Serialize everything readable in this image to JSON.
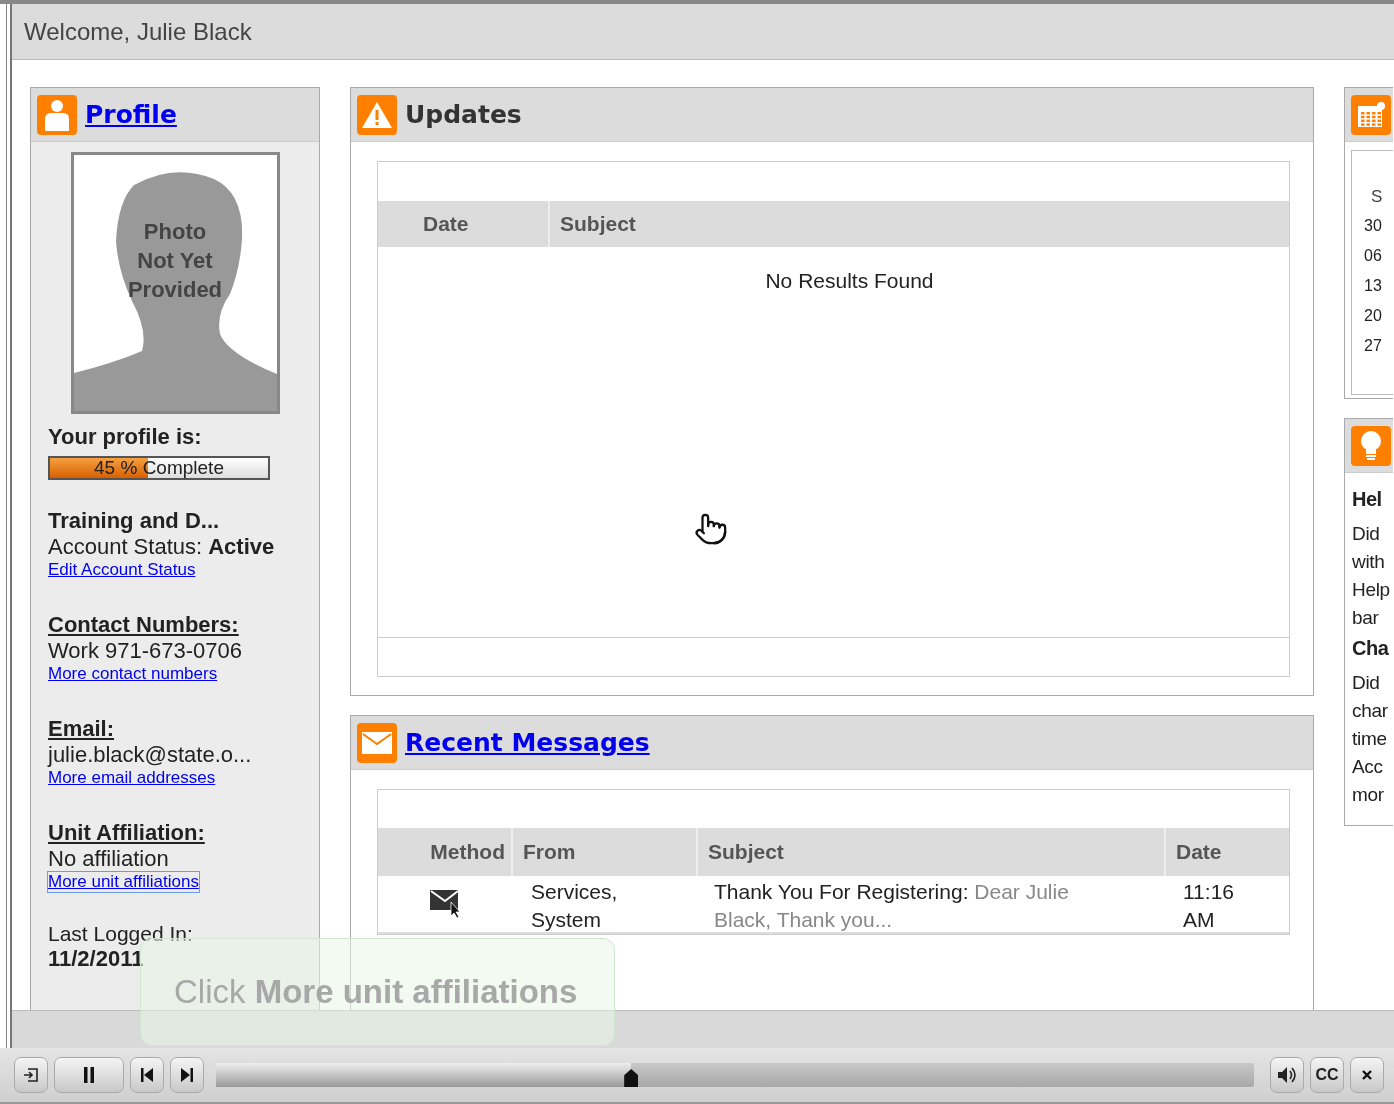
{
  "welcome": "Welcome, Julie Black",
  "profile": {
    "title": "Profile",
    "photo_text": [
      "Photo",
      "Not Yet",
      "Provided"
    ],
    "status_label": "Your profile is:",
    "progress": {
      "level": 0.45,
      "text": "45 % Complete"
    },
    "training": "Training and D...",
    "account_status": {
      "label": "Account Status:",
      "value": "Active"
    },
    "edit_link": "Edit Account Status",
    "sections": [
      {
        "heading": "Contact Numbers:",
        "value": "Work 971-673-0706",
        "link": "More contact numbers",
        "focused": false
      },
      {
        "heading": "Email:",
        "value": "julie.black@state.o...",
        "link": "More email addresses",
        "focused": false
      },
      {
        "heading": "Unit Affiliation:",
        "value": "No affiliation",
        "link": "More unit affiliations",
        "focused": true
      }
    ],
    "last_logged": {
      "label": "Last Logged In:",
      "value": "11/2/2011"
    }
  },
  "updates": {
    "title": "Updates",
    "columns": [
      "Date",
      "Subject"
    ],
    "empty": "No Results Found"
  },
  "messages": {
    "title": "Recent Messages",
    "columns": [
      "Method",
      "From",
      "Subject",
      "Date"
    ],
    "rows": [
      {
        "kind": "email",
        "from": "Services, System",
        "subject": "Thank You For Registering:",
        "preview": "Dear Julie Black, Thank you...",
        "date": "11:16 AM"
      }
    ]
  },
  "calendar": {
    "day_header": "S",
    "days": [
      "30",
      "06",
      "13",
      "20",
      "27"
    ]
  },
  "help": {
    "sections": [
      {
        "heading": "Hel",
        "lines": [
          "Did",
          "with",
          "Help",
          "bar"
        ]
      },
      {
        "heading": "Cha",
        "lines": [
          "Did",
          "char",
          "time",
          "Acc",
          "mor"
        ]
      }
    ]
  },
  "tooltip": "Click **More unit affiliations**",
  "player": {
    "seek": {
      "level": 0.4
    },
    "captions": "CC"
  }
}
